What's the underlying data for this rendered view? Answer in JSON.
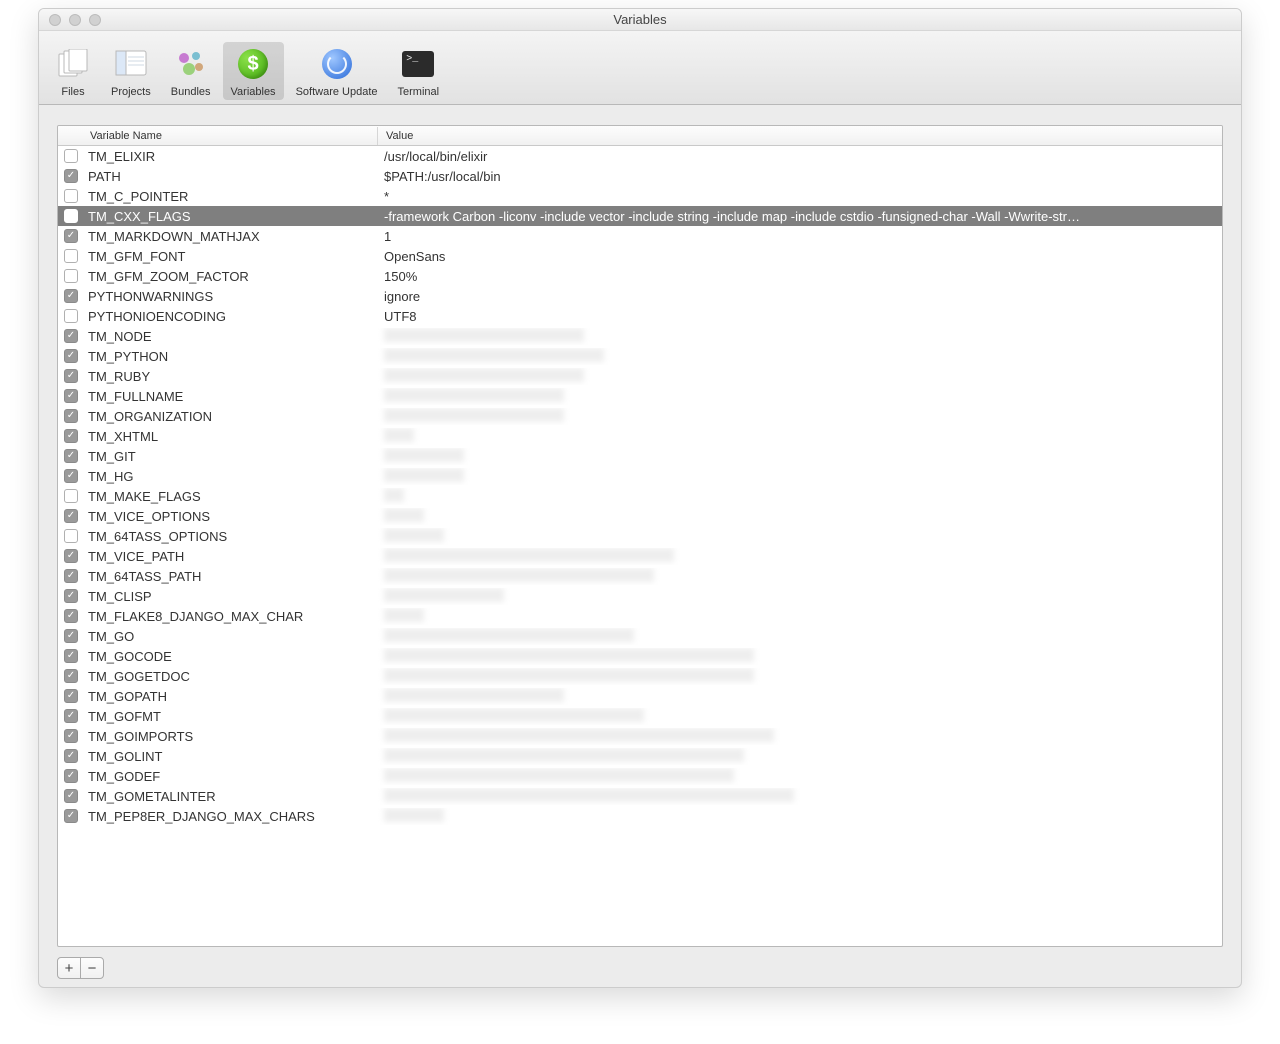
{
  "window": {
    "title": "Variables"
  },
  "toolbar": {
    "items": [
      {
        "label": "Files",
        "icon": "files-icon",
        "active": false
      },
      {
        "label": "Projects",
        "icon": "projects-icon",
        "active": false
      },
      {
        "label": "Bundles",
        "icon": "bundles-icon",
        "active": false
      },
      {
        "label": "Variables",
        "icon": "variables-icon",
        "active": true
      },
      {
        "label": "Software Update",
        "icon": "software-update-icon",
        "active": false
      },
      {
        "label": "Terminal",
        "icon": "terminal-icon",
        "active": false
      }
    ]
  },
  "columns": {
    "check": "",
    "name": "Variable Name",
    "value": "Value"
  },
  "selected_index": 3,
  "rows": [
    {
      "enabled": false,
      "name": "TM_ELIXIR",
      "value": "/usr/local/bin/elixir",
      "redacted": false
    },
    {
      "enabled": true,
      "name": "PATH",
      "value": "$PATH:/usr/local/bin",
      "redacted": false
    },
    {
      "enabled": false,
      "name": "TM_C_POINTER",
      "value": "*",
      "redacted": false
    },
    {
      "enabled": false,
      "name": "TM_CXX_FLAGS",
      "value": "-framework Carbon -liconv -include vector -include string -include map -include cstdio -funsigned-char -Wall -Wwrite-str…",
      "redacted": false
    },
    {
      "enabled": true,
      "name": "TM_MARKDOWN_MATHJAX",
      "value": "1",
      "redacted": false
    },
    {
      "enabled": false,
      "name": "TM_GFM_FONT",
      "value": "OpenSans",
      "redacted": false
    },
    {
      "enabled": false,
      "name": "TM_GFM_ZOOM_FACTOR",
      "value": "150%",
      "redacted": false
    },
    {
      "enabled": true,
      "name": "PYTHONWARNINGS",
      "value": "ignore",
      "redacted": false
    },
    {
      "enabled": false,
      "name": "PYTHONIOENCODING",
      "value": "UTF8",
      "redacted": false
    },
    {
      "enabled": true,
      "name": "TM_NODE",
      "value": "",
      "redacted": true,
      "redact_w": 200
    },
    {
      "enabled": true,
      "name": "TM_PYTHON",
      "value": "",
      "redacted": true,
      "redact_w": 220
    },
    {
      "enabled": true,
      "name": "TM_RUBY",
      "value": "",
      "redacted": true,
      "redact_w": 200
    },
    {
      "enabled": true,
      "name": "TM_FULLNAME",
      "value": "",
      "redacted": true,
      "redact_w": 180
    },
    {
      "enabled": true,
      "name": "TM_ORGANIZATION",
      "value": "",
      "redacted": true,
      "redact_w": 180
    },
    {
      "enabled": true,
      "name": "TM_XHTML",
      "value": "",
      "redacted": true,
      "redact_w": 30
    },
    {
      "enabled": true,
      "name": "TM_GIT",
      "value": "",
      "redacted": true,
      "redact_w": 80
    },
    {
      "enabled": true,
      "name": "TM_HG",
      "value": "",
      "redacted": true,
      "redact_w": 80
    },
    {
      "enabled": false,
      "name": "TM_MAKE_FLAGS",
      "value": "",
      "redacted": true,
      "redact_w": 20
    },
    {
      "enabled": true,
      "name": "TM_VICE_OPTIONS",
      "value": "",
      "redacted": true,
      "redact_w": 40
    },
    {
      "enabled": false,
      "name": "TM_64TASS_OPTIONS",
      "value": "",
      "redacted": true,
      "redact_w": 60
    },
    {
      "enabled": true,
      "name": "TM_VICE_PATH",
      "value": "",
      "redacted": true,
      "redact_w": 290
    },
    {
      "enabled": true,
      "name": "TM_64TASS_PATH",
      "value": "",
      "redacted": true,
      "redact_w": 270
    },
    {
      "enabled": true,
      "name": "TM_CLISP",
      "value": "",
      "redacted": true,
      "redact_w": 120
    },
    {
      "enabled": true,
      "name": "TM_FLAKE8_DJANGO_MAX_CHAR",
      "value": "",
      "redacted": true,
      "redact_w": 40
    },
    {
      "enabled": true,
      "name": "TM_GO",
      "value": "",
      "redacted": true,
      "redact_w": 250
    },
    {
      "enabled": true,
      "name": "TM_GOCODE",
      "value": "",
      "redacted": true,
      "redact_w": 370
    },
    {
      "enabled": true,
      "name": "TM_GOGETDOC",
      "value": "",
      "redacted": true,
      "redact_w": 370
    },
    {
      "enabled": true,
      "name": "TM_GOPATH",
      "value": "",
      "redacted": true,
      "redact_w": 180
    },
    {
      "enabled": true,
      "name": "TM_GOFMT",
      "value": "",
      "redacted": true,
      "redact_w": 260
    },
    {
      "enabled": true,
      "name": "TM_GOIMPORTS",
      "value": "",
      "redacted": true,
      "redact_w": 390
    },
    {
      "enabled": true,
      "name": "TM_GOLINT",
      "value": "",
      "redacted": true,
      "redact_w": 360
    },
    {
      "enabled": true,
      "name": "TM_GODEF",
      "value": "",
      "redacted": true,
      "redact_w": 350
    },
    {
      "enabled": true,
      "name": "TM_GOMETALINTER",
      "value": "",
      "redacted": true,
      "redact_w": 410
    },
    {
      "enabled": true,
      "name": "TM_PEP8ER_DJANGO_MAX_CHARS",
      "value": "",
      "redacted": true,
      "redact_w": 60
    }
  ],
  "footer": {
    "add": "+",
    "remove": "−"
  }
}
